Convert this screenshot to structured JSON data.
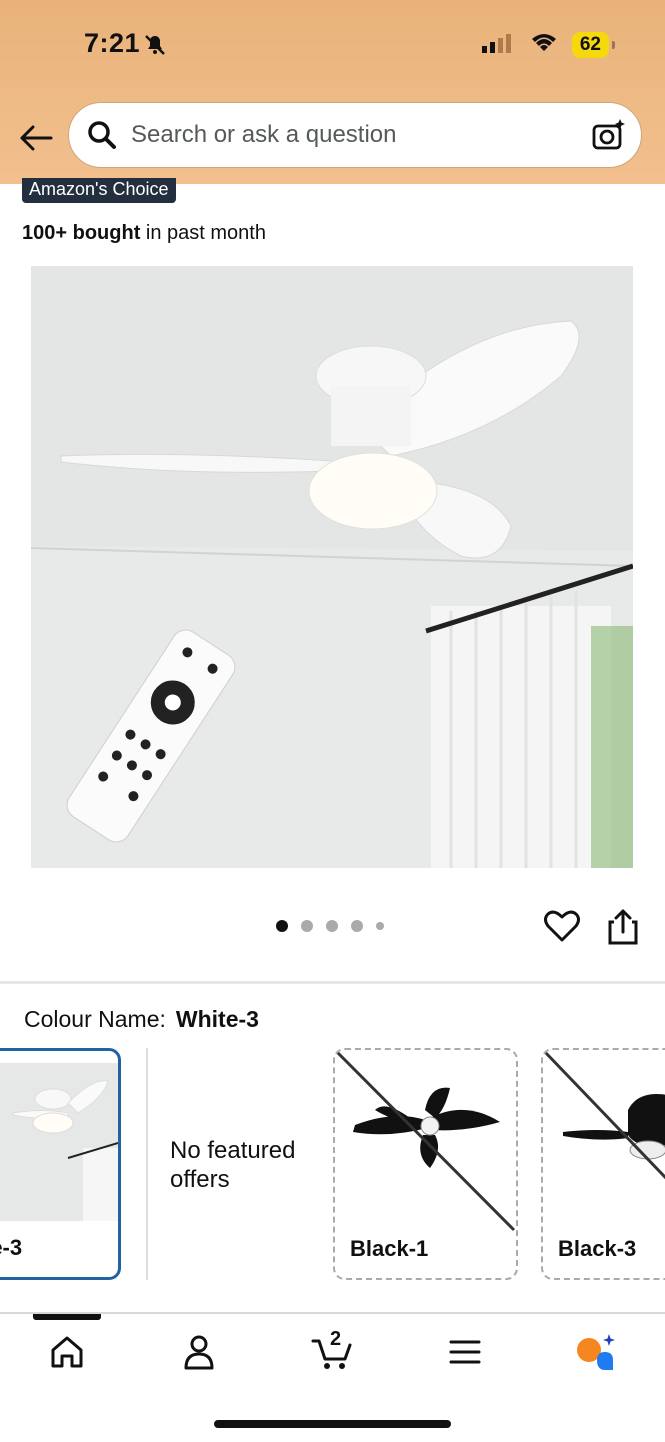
{
  "status": {
    "time": "7:21",
    "battery": "62"
  },
  "search": {
    "placeholder": "Search or ask a question"
  },
  "product": {
    "badge": "Amazon's Choice",
    "bought_bold": "100+ bought",
    "bought_rest": " in past month",
    "gallery": {
      "total_images": 5,
      "current_index": 1
    }
  },
  "colour": {
    "label": "Colour Name:",
    "selected": "White-3",
    "options": [
      {
        "label": "te-3",
        "state": "selected"
      },
      {
        "label": "Black-1",
        "state": "unavailable"
      },
      {
        "label": "Black-3",
        "state": "unavailable"
      }
    ],
    "no_offers": "No featured offers"
  },
  "nav": {
    "cart_count": "2"
  },
  "colors": {
    "accent": "#2162a1",
    "header": "#f2c08e",
    "badge": "#232f3e",
    "battery": "#f5d90a"
  }
}
